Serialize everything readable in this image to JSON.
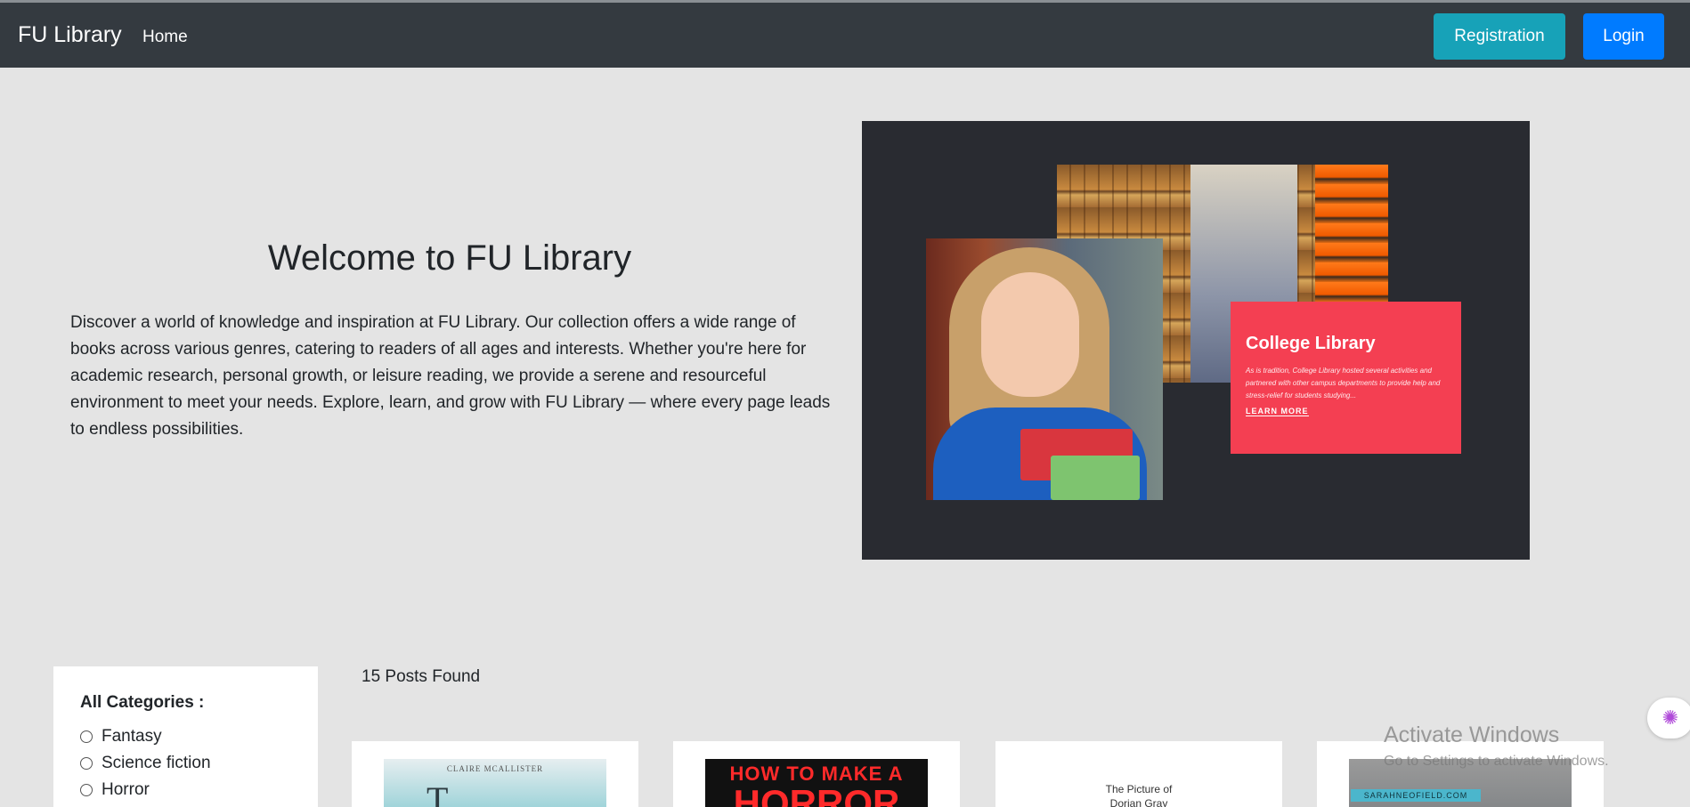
{
  "navbar": {
    "brand": "FU Library",
    "home": "Home",
    "registration": "Registration",
    "login": "Login"
  },
  "hero": {
    "title": "Welcome to FU Library",
    "text": "Discover a world of knowledge and inspiration at FU Library. Our collection offers a wide range of books across various genres, catering to readers of all ages and interests. Whether you're here for academic research, personal growth, or leisure reading, we provide a serene and resourceful environment to meet your needs. Explore, learn, and grow with FU Library — where every page leads to endless possibilities.",
    "image": {
      "card_title": "College Library",
      "card_desc": "As is tradition, College Library hosted several activities and partnered with other campus departments to provide help and stress-relief for students studying...",
      "card_link": "LEARN MORE"
    }
  },
  "sidebar": {
    "title": "All Categories :",
    "categories": [
      "Fantasy",
      "Science fiction",
      "Horror"
    ]
  },
  "posts": {
    "count_text": "15 Posts Found",
    "books": [
      {
        "cover_author": "CLAIRE MCALLISTER",
        "cover_title": "T"
      },
      {
        "cover_line1": "HOW TO MAKE A",
        "cover_line2": "HORROR"
      },
      {
        "cover_line1": "The Picture of",
        "cover_line2": "Dorian Gray"
      },
      {
        "cover_strip": "SARAHNEOFIELD.COM"
      }
    ]
  },
  "overlay": {
    "activate_title": "Activate Windows",
    "activate_sub": "Go to Settings to activate Windows."
  }
}
